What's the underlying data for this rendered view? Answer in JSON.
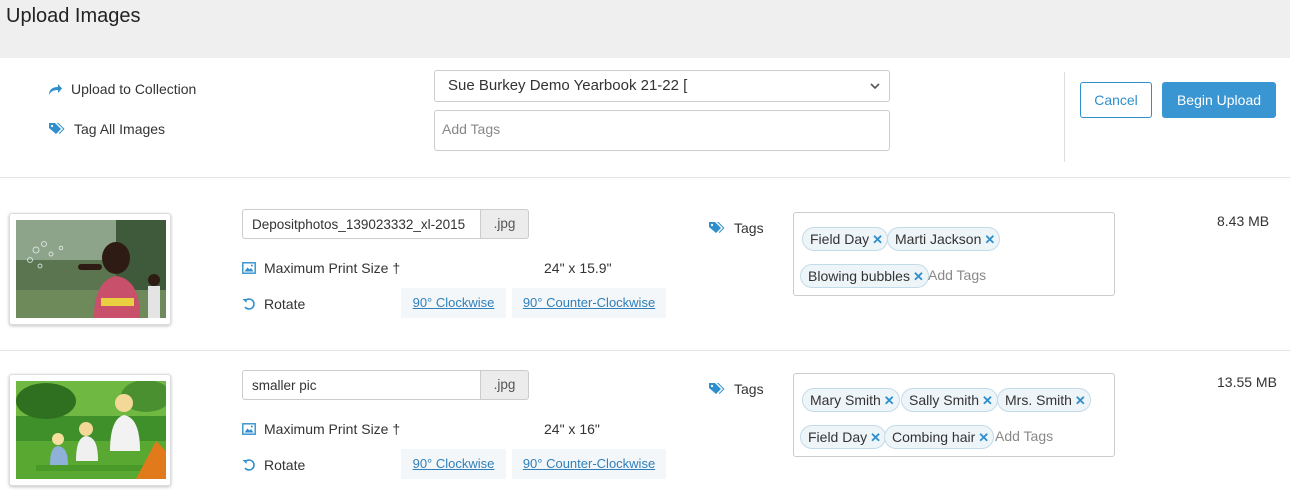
{
  "page": {
    "title": "Upload Images"
  },
  "header": {
    "upload_to_collection_label": "Upload to Collection",
    "tag_all_images_label": "Tag All Images",
    "collection_selected": "Sue Burkey Demo Yearbook 21-22 [",
    "tag_all_placeholder": "Add Tags",
    "cancel_label": "Cancel",
    "begin_upload_label": "Begin Upload"
  },
  "images": [
    {
      "filename": "Depositphotos_139023332_xl-2015",
      "extension": ".jpg",
      "max_print_label": "Maximum Print Size †",
      "max_print_value": "24\" x 15.9\"",
      "rotate_label": "Rotate",
      "rotate_cw": "90° Clockwise",
      "rotate_ccw": "90° Counter-Clockwise",
      "tags_label": "Tags",
      "tags": [
        "Field Day",
        "Marti Jackson",
        "Blowing bubbles"
      ],
      "tag_placeholder": "Add Tags",
      "size": "8.43 MB"
    },
    {
      "filename": "smaller pic",
      "extension": ".jpg",
      "max_print_label": "Maximum Print Size †",
      "max_print_value": "24\" x 16\"",
      "rotate_label": "Rotate",
      "rotate_cw": "90° Clockwise",
      "rotate_ccw": "90° Counter-Clockwise",
      "tags_label": "Tags",
      "tags": [
        "Mary Smith",
        "Sally Smith",
        "Mrs. Smith",
        "Field Day",
        "Combing hair"
      ],
      "tag_placeholder": "Add Tags",
      "size": "13.55 MB"
    }
  ],
  "colors": {
    "accent": "#3996d3",
    "link": "#2f7fba",
    "chip_bg": "#eef5f9"
  }
}
